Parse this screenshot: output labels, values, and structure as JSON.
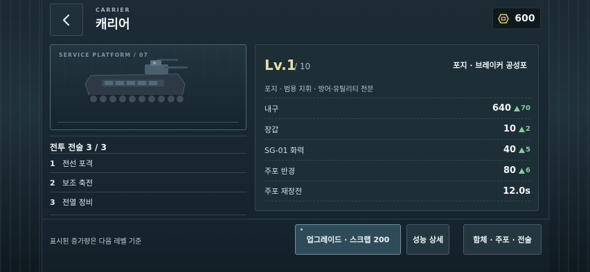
{
  "header": {
    "kicker": "CARRIER",
    "title": "캐리어",
    "currency_icon": "scrap-chip-icon",
    "currency_amount": "600"
  },
  "vehicle": {
    "label": "SERVICE PLATFORM / 07"
  },
  "tactics": {
    "title": "전투 전술 3 / 3",
    "items": [
      {
        "num": "1",
        "label": "전선 포격"
      },
      {
        "num": "2",
        "label": "보조 축전"
      },
      {
        "num": "3",
        "label": "전열 정비"
      }
    ]
  },
  "stats": {
    "level": "Lv.1",
    "level_max": "/ 10",
    "weapon": "포지 · 브레이커 공성포",
    "role": "포지 · 범용 지휘 · 방어·유틸리티 전문",
    "rows": [
      {
        "name": "내구",
        "value": "640",
        "inc": "70"
      },
      {
        "name": "장갑",
        "value": "10",
        "inc": "2"
      },
      {
        "name": "SG-01 화력",
        "value": "40",
        "inc": "5"
      },
      {
        "name": "주포 반경",
        "value": "80",
        "inc": "6"
      },
      {
        "name": "주포 재장전",
        "value": "12.0s",
        "inc": ""
      }
    ],
    "inc_color": "#7fd09a"
  },
  "footer": {
    "note": "표시된 증가량은 다음 레벨 기준",
    "buttons": {
      "upgrade": "업그레이드 · 스크랩 200",
      "details": "성능 상세",
      "loadout": "함체 · 주포 · 전술"
    }
  }
}
